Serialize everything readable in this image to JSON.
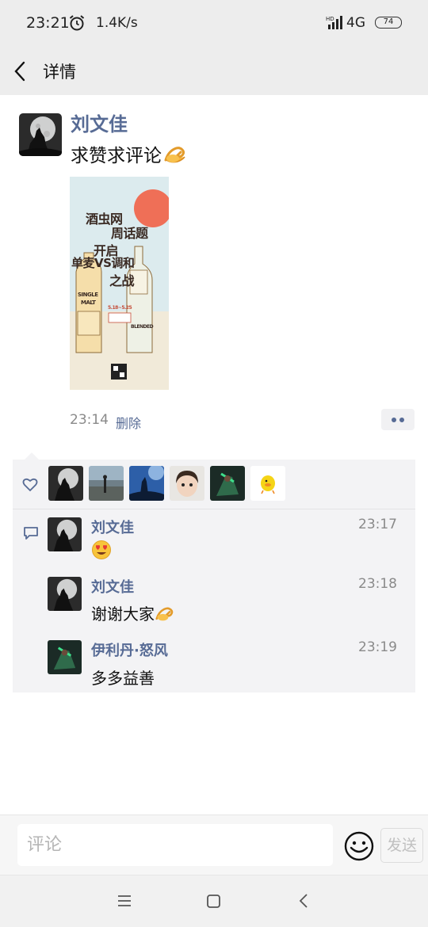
{
  "status_bar": {
    "time": "23:21",
    "speed": "1.4K/s",
    "network": "4G",
    "battery": "74"
  },
  "header": {
    "title": "详情"
  },
  "post": {
    "author": "刘文佳",
    "text": "求赞求评论",
    "emoji": "ok-hand",
    "image": {
      "lines": [
        "酒虫网",
        "周话题",
        "开启",
        "单麦VS调和",
        "之战"
      ],
      "bottle_left": [
        "SINGLE",
        "MALT"
      ],
      "bottle_right": "BLENDED",
      "date": "5.18~5.25"
    },
    "time": "23:14",
    "delete_label": "删除"
  },
  "likes": {
    "avatars": [
      "wolf-moon-avatar",
      "landscape-avatar",
      "sky-silhouette-avatar",
      "child-avatar",
      "warcraft-avatar",
      "duck-avatar"
    ]
  },
  "comments": [
    {
      "name": "刘文佳",
      "time": "23:17",
      "text": "",
      "emoji": "heart-eyes"
    },
    {
      "name": "刘文佳",
      "time": "23:18",
      "text": "谢谢大家",
      "emoji": "ok-hand"
    },
    {
      "name": "伊利丹·怒风",
      "time": "23:19",
      "text": "多多益善",
      "emoji": ""
    }
  ],
  "comment_bar": {
    "placeholder": "评论",
    "send_label": "发送"
  },
  "colors": {
    "link": "#576b95",
    "header_bg": "#ededed",
    "panel_bg": "#f3f3f5"
  }
}
